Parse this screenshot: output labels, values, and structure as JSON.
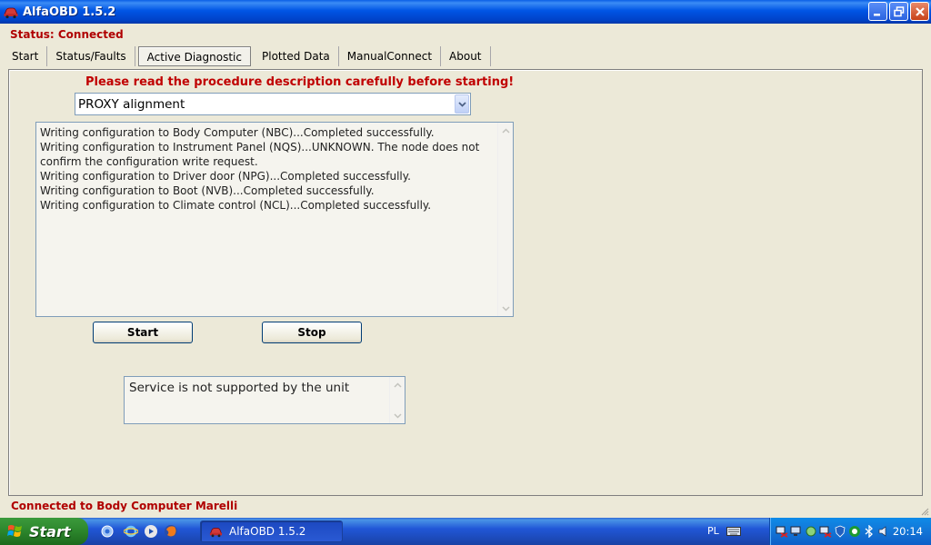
{
  "window": {
    "title": "AlfaOBD 1.5.2"
  },
  "status": "Status: Connected",
  "tabs": [
    {
      "label": "Start"
    },
    {
      "label": "Status/Faults"
    },
    {
      "label": "Active Diagnostic",
      "active": true
    },
    {
      "label": "Plotted Data"
    },
    {
      "label": "ManualConnect"
    },
    {
      "label": "About"
    }
  ],
  "warning": "Please read the procedure description carefully before starting!",
  "procedure_select": {
    "value": "PROXY alignment"
  },
  "log_lines": [
    "Writing configuration to Body Computer (NBC)...Completed successfully.",
    "Writing configuration to Instrument Panel (NQS)...UNKNOWN. The node does not",
    "confirm the configuration write request.",
    "Writing configuration to Driver door (NPG)...Completed successfully.",
    "Writing configuration to Boot (NVB)...Completed successfully.",
    "Writing configuration to Climate control (NCL)...Completed successfully."
  ],
  "buttons": {
    "start": "Start",
    "stop": "Stop"
  },
  "message": "Service is not supported by the unit",
  "bottom_status": "Connected to Body Computer Marelli",
  "taskbar": {
    "start_label": "Start",
    "task_label": "AlfaOBD 1.5.2",
    "language": "PL",
    "clock": "20:14"
  },
  "colors": {
    "status_red": "#b00000",
    "titlebar_blue": "#0055e5",
    "start_green": "#2f8a2f"
  }
}
